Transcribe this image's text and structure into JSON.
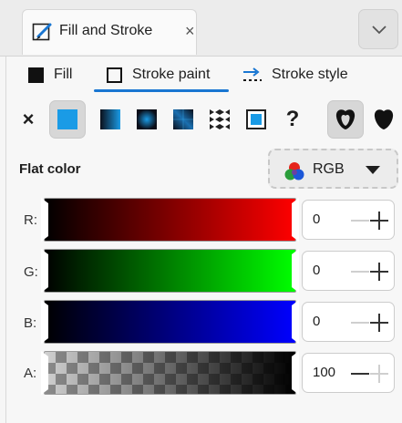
{
  "dock": {
    "tab_title": "Fill and Stroke",
    "tab_close": "×"
  },
  "tabs": [
    {
      "label": "Fill",
      "icon": "filled-square-icon",
      "selected": false
    },
    {
      "label": "Stroke paint",
      "icon": "outline-square-icon",
      "selected": true
    },
    {
      "label": "Stroke style",
      "icon": "stroke-style-icon",
      "selected": false
    }
  ],
  "paint_types": [
    {
      "name": "none",
      "glyph": "×"
    },
    {
      "name": "flat-color",
      "selected": true
    },
    {
      "name": "linear-gradient"
    },
    {
      "name": "radial-gradient"
    },
    {
      "name": "mesh-gradient"
    },
    {
      "name": "pattern"
    },
    {
      "name": "swatch"
    },
    {
      "name": "unset",
      "glyph": "?"
    }
  ],
  "fill_rules": [
    {
      "name": "evenodd-fill-rule",
      "selected": true
    },
    {
      "name": "nonzero-fill-rule",
      "selected": false
    }
  ],
  "colors": {
    "accent": "#1976d2",
    "flat": "#1a9be6"
  },
  "color_section": {
    "title": "Flat color",
    "mode": "RGB"
  },
  "channels": [
    {
      "label": "R:",
      "value": "0"
    },
    {
      "label": "G:",
      "value": "0"
    },
    {
      "label": "B:",
      "value": "0"
    },
    {
      "label": "A:",
      "value": "100"
    }
  ]
}
